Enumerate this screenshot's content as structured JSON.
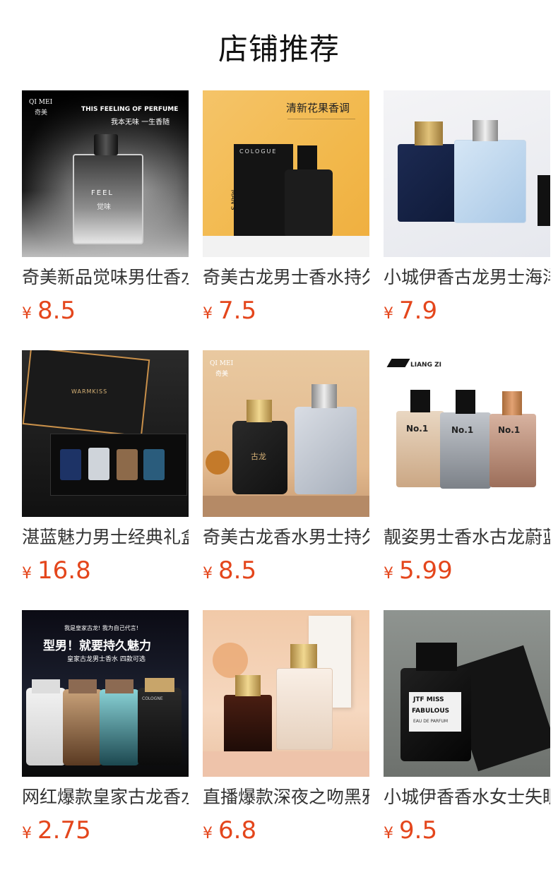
{
  "header": {
    "title": "店铺推荐"
  },
  "currency": "¥",
  "products": [
    {
      "name": "奇美新品觉味男仕香水",
      "price": "8.5",
      "image_text": {
        "brand": "QI MEI",
        "brand_cn": "奇美",
        "tagline_en": "THIS FEELING OF PERFUME",
        "tagline_cn": "我本无味 一生香随",
        "label": "FEEL",
        "label_cn": "觉味"
      }
    },
    {
      "name": "奇美古龙男士香水持久",
      "price": "7.5",
      "image_text": {
        "headline": "清新花果香调",
        "box_text": "COLOGUE",
        "side_text": "MAN'S"
      }
    },
    {
      "name": "小城伊香古龙男士海洋",
      "price": "7.9",
      "image_text": {}
    },
    {
      "name": "湛蓝魅力男士经典礼盒",
      "price": "16.8",
      "image_text": {
        "brand": "WARMKISS"
      }
    },
    {
      "name": "奇美古龙香水男士持久",
      "price": "8.5",
      "image_text": {
        "brand": "QI MEI",
        "brand_cn": "奇美",
        "label": "古龙"
      }
    },
    {
      "name": "靓姿男士香水古龙蔚蓝",
      "price": "5.99",
      "image_text": {
        "brand": "LIANG ZI",
        "bottle_label": "No.1"
      }
    },
    {
      "name": "网红爆款皇家古龙香水",
      "price": "2.75",
      "image_text": {
        "small": "我是皇家古龙! 我为自己代言!",
        "headline": "型男！就要持久魅力",
        "sub": "皇家古龙男士香水 四款可选",
        "bottle_label": "COLOGNE"
      }
    },
    {
      "name": "直播爆款深夜之吻黑鸦片",
      "price": "6.8",
      "image_text": {}
    },
    {
      "name": "小城伊香香水女士失眠",
      "price": "9.5",
      "image_text": {
        "label1": "JTF MISS",
        "label2": "FABULOUS",
        "label3": "EAU DE PARFUM"
      }
    }
  ]
}
